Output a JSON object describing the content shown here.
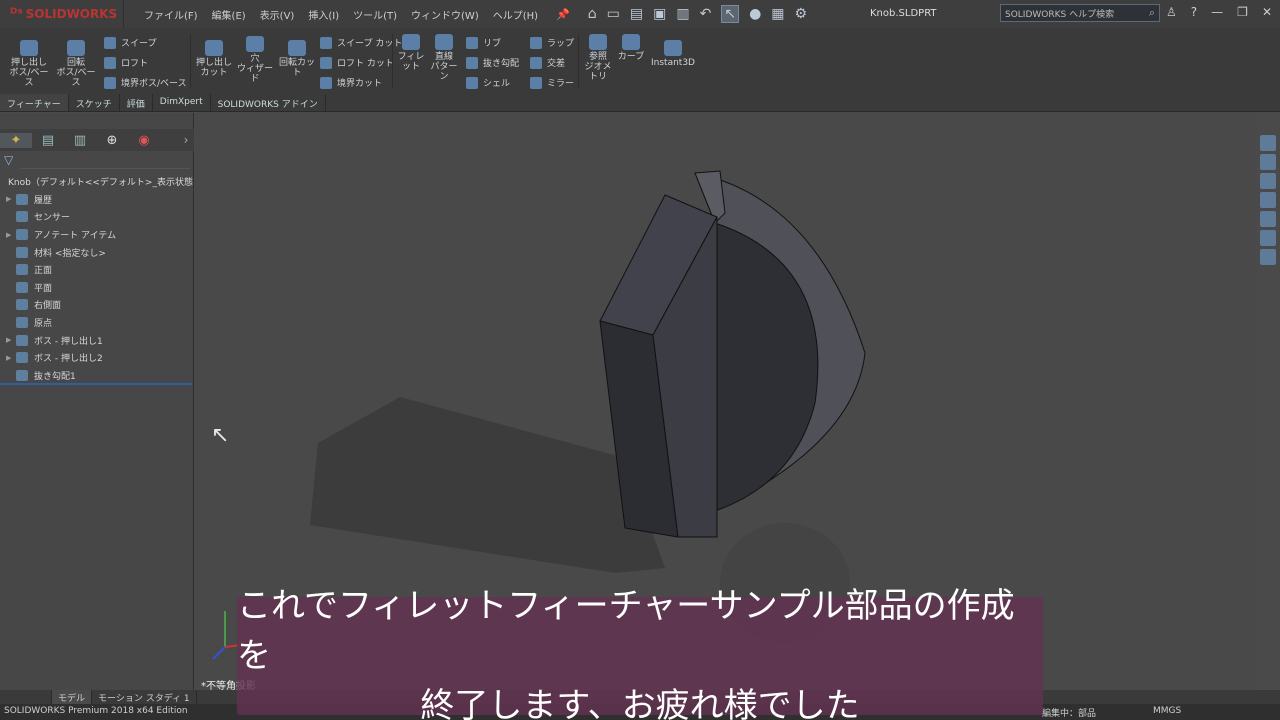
{
  "app": {
    "logo_text": "SOLIDWORKS",
    "document_title": "Knob.SLDPRT"
  },
  "menu": [
    "ファイル(F)",
    "編集(E)",
    "表示(V)",
    "挿入(I)",
    "ツール(T)",
    "ウィンドウ(W)",
    "ヘルプ(H)"
  ],
  "search": {
    "placeholder": "SOLIDWORKS ヘルプ検索"
  },
  "features": {
    "extrude_boss": "押し出し\nボス/ベース",
    "revolve_boss": "回転\nボス/ベース",
    "sweep": "スイープ",
    "loft": "ロフト",
    "boundary_boss": "境界ボス/ベース",
    "extrude_cut": "押し出し\nカット",
    "hole_wizard": "穴\nウィザード",
    "revolve_cut": "回転カット",
    "swept_cut": "スイープ カット",
    "lofted_cut": "ロフト カット",
    "boundary_cut": "境界カット",
    "fillet": "フィレット",
    "linear_pattern": "直線\nパターン",
    "rib": "リブ",
    "draft": "抜き勾配",
    "shell": "シェル",
    "wrap": "ラップ",
    "intersect": "交差",
    "mirror": "ミラー",
    "ref_geometry": "参照\nジオメトリ",
    "curves": "カーブ",
    "instant3d": "Instant3D"
  },
  "cm_tabs": [
    "フィーチャー",
    "スケッチ",
    "評価",
    "DimXpert",
    "SOLIDWORKS アドイン"
  ],
  "tree": {
    "root": "Knob（デフォルト<<デフォルト>_表示状態 1>）",
    "items": [
      {
        "label": "履歴",
        "expandable": true
      },
      {
        "label": "センサー",
        "expandable": false
      },
      {
        "label": "アノテート アイテム",
        "expandable": true
      },
      {
        "label": "材料 <指定なし>",
        "expandable": false
      },
      {
        "label": "正面",
        "expandable": false
      },
      {
        "label": "平面",
        "expandable": false
      },
      {
        "label": "右側面",
        "expandable": false
      },
      {
        "label": "原点",
        "expandable": false
      },
      {
        "label": "ボス - 押し出し1",
        "expandable": true
      },
      {
        "label": "ボス - 押し出し2",
        "expandable": true
      },
      {
        "label": "抜き勾配1",
        "expandable": false
      }
    ]
  },
  "view": {
    "projection": "*不等角投影"
  },
  "bottom_tabs": [
    "モデル",
    "モーション スタディ 1"
  ],
  "status": {
    "edition": "SOLIDWORKS Premium 2018 x64 Edition",
    "editing": "編集中：部品",
    "units": "MMGS"
  },
  "subtitle": {
    "line1": "これでフィレットフィーチャーサンプル部品の作成を",
    "line2": "終了します、お疲れ様でした"
  },
  "colors": {
    "accent": "#2d5ea8",
    "subtitle_bg": "#643250"
  }
}
